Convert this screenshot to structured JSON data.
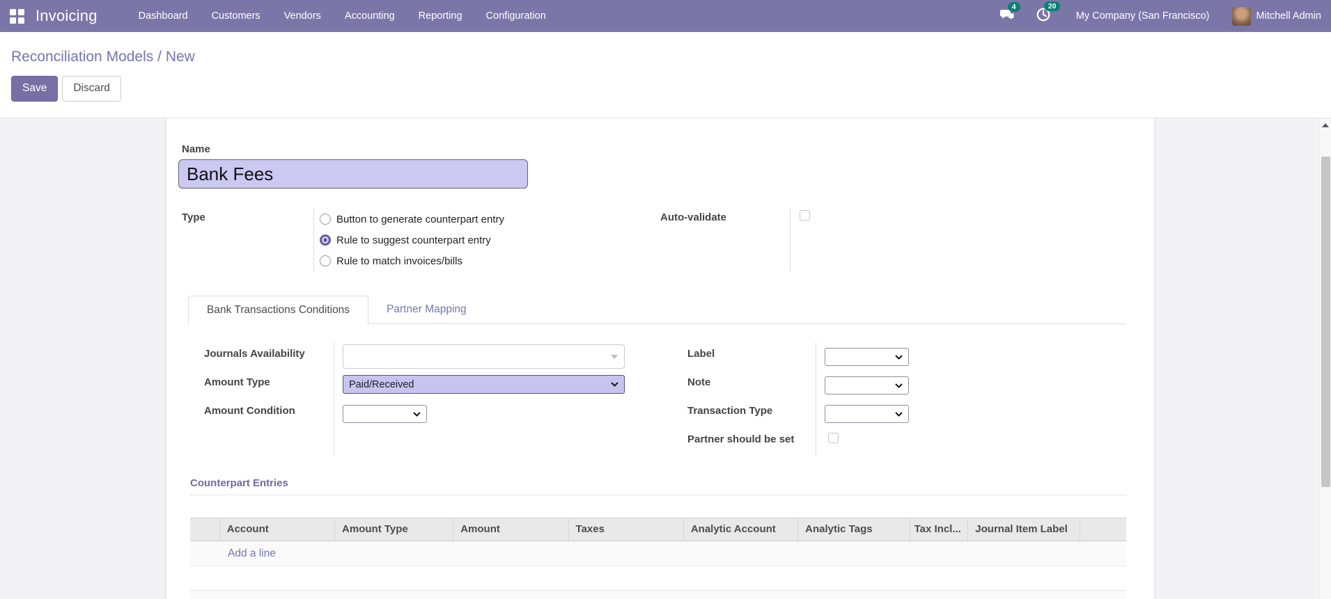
{
  "topbar": {
    "app_name": "Invoicing",
    "menu": [
      "Dashboard",
      "Customers",
      "Vendors",
      "Accounting",
      "Reporting",
      "Configuration"
    ],
    "messages_badge": "4",
    "activities_badge": "20",
    "company": "My Company (San Francisco)",
    "user": "Mitchell Admin"
  },
  "control_panel": {
    "breadcrumb_parent": "Reconciliation Models",
    "breadcrumb_separator": "/",
    "breadcrumb_current": "New",
    "save_label": "Save",
    "discard_label": "Discard"
  },
  "form": {
    "name_label": "Name",
    "name_value": "Bank Fees",
    "type_label": "Type",
    "type_options": [
      {
        "label": "Button to generate counterpart entry",
        "selected": false
      },
      {
        "label": "Rule to suggest counterpart entry",
        "selected": true
      },
      {
        "label": "Rule to match invoices/bills",
        "selected": false
      }
    ],
    "auto_validate_label": "Auto-validate",
    "auto_validate_checked": false,
    "tabs": [
      {
        "label": "Bank Transactions Conditions",
        "active": true
      },
      {
        "label": "Partner Mapping",
        "active": false
      }
    ],
    "fields": {
      "journals_availability_label": "Journals Availability",
      "journals_availability_value": "",
      "amount_type_label": "Amount Type",
      "amount_type_value": "Paid/Received",
      "amount_condition_label": "Amount Condition",
      "amount_condition_value": "",
      "label_label": "Label",
      "label_value": "",
      "note_label": "Note",
      "note_value": "",
      "transaction_type_label": "Transaction Type",
      "transaction_type_value": "",
      "partner_should_be_set_label": "Partner should be set",
      "partner_should_be_set_checked": false
    },
    "counterpart": {
      "title": "Counterpart Entries",
      "columns": [
        "Account",
        "Amount Type",
        "Amount",
        "Taxes",
        "Analytic Account",
        "Analytic Tags",
        "Tax Incl...",
        "Journal Item Label"
      ],
      "add_line_label": "Add a line"
    }
  },
  "colors": {
    "topbar": "#7b76a8",
    "badge": "#0b8176",
    "link": "#7577b2",
    "highlight_bg": "#cbc8f2"
  }
}
